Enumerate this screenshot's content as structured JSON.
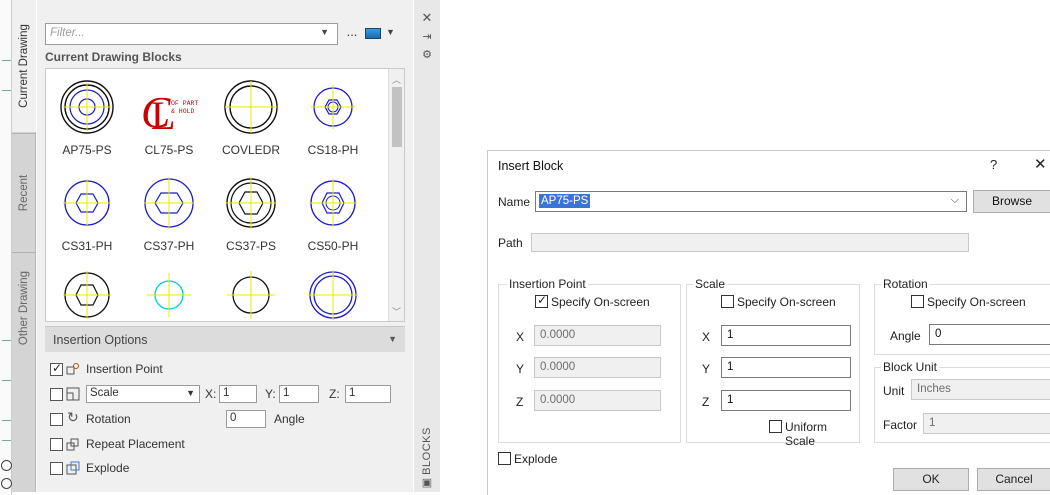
{
  "palette": {
    "tabs": [
      "Current Drawing",
      "Recent",
      "Other Drawing"
    ],
    "filter_placeholder": "Filter...",
    "ellipsis": "...",
    "section_title": "Current Drawing Blocks",
    "blocks": [
      {
        "name": "AP75-PS"
      },
      {
        "name": "CL75-PS"
      },
      {
        "name": "COVLEDR"
      },
      {
        "name": "CS18-PH"
      },
      {
        "name": "CS31-PH"
      },
      {
        "name": "CS37-PH"
      },
      {
        "name": "CS37-PS"
      },
      {
        "name": "CS50-PH"
      },
      {
        "name": ""
      },
      {
        "name": ""
      },
      {
        "name": ""
      },
      {
        "name": ""
      }
    ],
    "cl_text": "OF PART\n& HOLD",
    "options_title": "Insertion Options",
    "options": {
      "insertion_point": "Insertion Point",
      "scale": "Scale",
      "scale_x_label": "X:",
      "scale_x": "1",
      "scale_y_label": "Y:",
      "scale_y": "1",
      "scale_z_label": "Z:",
      "scale_z": "1",
      "rotation": "Rotation",
      "rotation_value": "0",
      "angle": "Angle",
      "repeat": "Repeat Placement",
      "explode": "Explode"
    },
    "side_label": "BLOCKS",
    "colors": {
      "accent_red": "#cc0000",
      "blue": "#1a1acc",
      "yellow": "#e8e800",
      "cyan": "#00c8e0"
    }
  },
  "dialog": {
    "title": "Insert Block",
    "help": "?",
    "close": "✕",
    "name_label": "Name",
    "name_value": "AP75-PS",
    "browse": "Browse",
    "path_label": "Path",
    "insertion": {
      "title": "Insertion Point",
      "specify": "Specify On-screen",
      "x_label": "X",
      "x": "0.0000",
      "y_label": "Y",
      "y": "0.0000",
      "z_label": "Z",
      "z": "0.0000"
    },
    "scale": {
      "title": "Scale",
      "specify": "Specify On-screen",
      "x_label": "X",
      "x": "1",
      "y_label": "Y",
      "y": "1",
      "z_label": "Z",
      "z": "1",
      "uniform": "Uniform Scale"
    },
    "rotation": {
      "title": "Rotation",
      "specify": "Specify On-screen",
      "angle_label": "Angle",
      "angle": "0"
    },
    "block_unit": {
      "title": "Block Unit",
      "unit_label": "Unit",
      "unit": "Inches",
      "factor_label": "Factor",
      "factor": "1"
    },
    "explode": "Explode",
    "ok": "OK",
    "cancel": "Cancel"
  }
}
